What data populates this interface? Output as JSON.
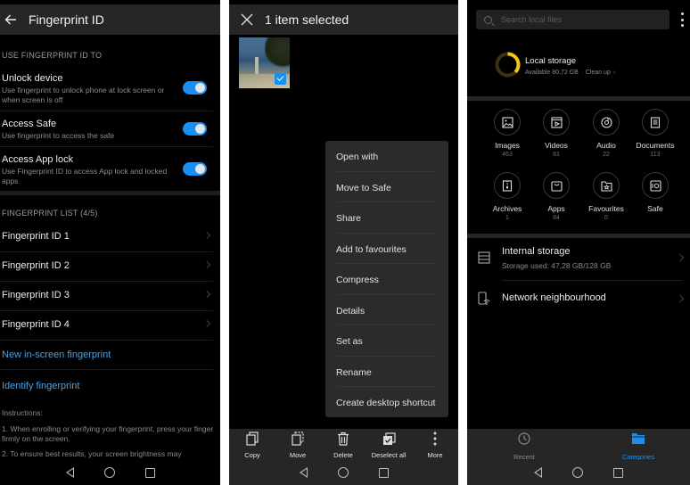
{
  "fingerprint_screen": {
    "title": "Fingerprint ID",
    "section_use": "USE FINGERPRINT ID TO",
    "toggles": [
      {
        "title": "Unlock device",
        "subtitle": "Use fingerprint to unlock phone at lock screen or when screen is off",
        "on": true
      },
      {
        "title": "Access Safe",
        "subtitle": "Use fingerprint to access the safe",
        "on": true
      },
      {
        "title": "Access App lock",
        "subtitle": "Use Fingerprint ID to access App lock and locked apps",
        "on": true
      }
    ],
    "section_list": "FINGERPRINT LIST (4/5)",
    "fingerprints": [
      "Fingerprint ID 1",
      "Fingerprint ID 2",
      "Fingerprint ID 3",
      "Fingerprint ID 4"
    ],
    "new_link": "New in-screen fingerprint",
    "identify_link": "Identify fingerprint",
    "instructions_header": "Instructions:",
    "instructions": [
      "1. When enrolling or verifying your fingerprint, press your finger firmly on the screen.",
      "2. To ensure best results, your screen brightness may"
    ],
    "colors": {
      "accent": "#1a8ff2",
      "link": "#4aa3e6"
    }
  },
  "selection_screen": {
    "title": "1 item selected",
    "selected_count": 1,
    "context_menu": [
      "Open with",
      "Move to Safe",
      "Share",
      "Add to favourites",
      "Compress",
      "Details",
      "Set as",
      "Rename",
      "Create desktop shortcut"
    ],
    "actions": [
      {
        "label": "Copy",
        "icon": "copy-icon"
      },
      {
        "label": "Move",
        "icon": "move-icon"
      },
      {
        "label": "Delete",
        "icon": "trash-icon"
      },
      {
        "label": "Deselect all",
        "icon": "deselect-all-icon"
      },
      {
        "label": "More",
        "icon": "more-vertical-icon"
      }
    ]
  },
  "files_screen": {
    "search_placeholder": "Search local files",
    "local_storage": {
      "title": "Local storage",
      "available": "Available 80,72 GB",
      "clean_up": "Clean up",
      "used_fraction": 0.37,
      "ring_color": "#f5c518"
    },
    "categories": [
      {
        "label": "Images",
        "count": "463",
        "icon": "image-icon"
      },
      {
        "label": "Videos",
        "count": "81",
        "icon": "video-icon"
      },
      {
        "label": "Audio",
        "count": "22",
        "icon": "audio-disc-icon"
      },
      {
        "label": "Documents",
        "count": "113",
        "icon": "document-icon"
      },
      {
        "label": "Archives",
        "count": "1",
        "icon": "archive-icon"
      },
      {
        "label": "Apps",
        "count": "84",
        "icon": "apps-bag-icon"
      },
      {
        "label": "Favourites",
        "count": "0",
        "icon": "favourites-folder-icon"
      },
      {
        "label": "Safe",
        "count": "",
        "icon": "safe-icon"
      }
    ],
    "internal_storage": {
      "title": "Internal storage",
      "subtitle": "Storage used: 47,28 GB/128 GB"
    },
    "network": {
      "title": "Network neighbourhood"
    },
    "tabs": [
      {
        "label": "Recent",
        "active": false
      },
      {
        "label": "Categories",
        "active": true
      }
    ],
    "colors": {
      "active_tab": "#1a8ff2",
      "inactive_tab": "#8a8a8a"
    }
  }
}
